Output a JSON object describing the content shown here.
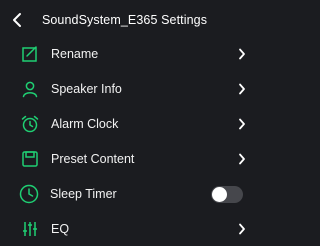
{
  "header": {
    "title": "SoundSystem_E365 Settings"
  },
  "accent_color": "#1fcf73",
  "items": [
    {
      "label": "Rename",
      "icon": "edit-icon",
      "control": "chevron"
    },
    {
      "label": "Speaker Info",
      "icon": "user-icon",
      "control": "chevron"
    },
    {
      "label": "Alarm Clock",
      "icon": "alarm-clock-icon",
      "control": "chevron"
    },
    {
      "label": "Preset Content",
      "icon": "preset-save-icon",
      "control": "chevron"
    },
    {
      "label": "Sleep Timer",
      "icon": "clock-icon",
      "control": "toggle",
      "toggle_on": false
    },
    {
      "label": "EQ",
      "icon": "equalizer-icon",
      "control": "chevron"
    }
  ]
}
